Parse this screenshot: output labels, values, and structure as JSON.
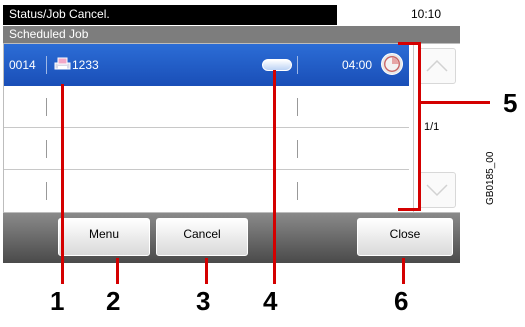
{
  "header": {
    "title": "Status/Job Cancel.",
    "time": "10:10"
  },
  "subheader": {
    "title": "Scheduled Job"
  },
  "job": {
    "number": "0014",
    "name": "1233",
    "scheduled_time": "04:00"
  },
  "scroll": {
    "page_indicator": "1/1"
  },
  "buttons": {
    "menu": "Menu",
    "cancel": "Cancel",
    "close": "Close"
  },
  "callouts": {
    "n1": "1",
    "n2": "2",
    "n3": "3",
    "n4": "4",
    "n5": "5",
    "n6": "6"
  },
  "figure_code": "GB0185_00",
  "colors": {
    "selection": "#1a4fb8",
    "callout_line": "#d40000"
  }
}
